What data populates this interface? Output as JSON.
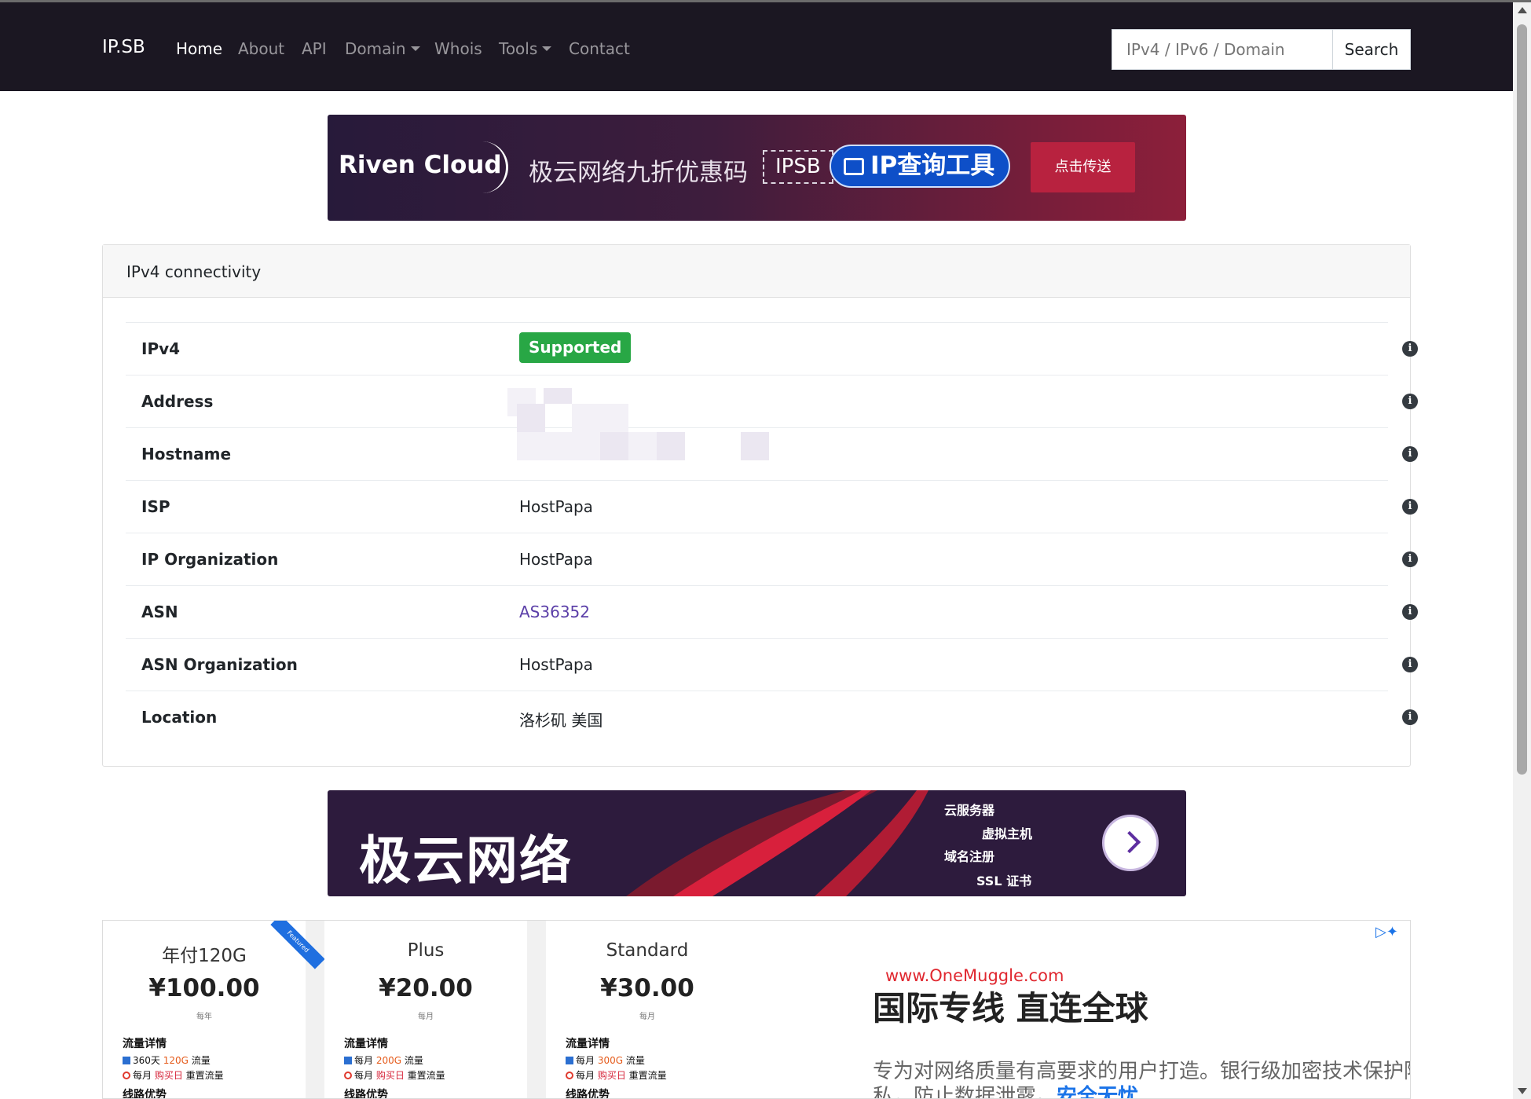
{
  "nav": {
    "brand": "IP.SB",
    "links": [
      "Home",
      "About",
      "API",
      "Domain",
      "Whois",
      "Tools",
      "Contact"
    ],
    "search_placeholder": "IPv4 / IPv6 / Domain",
    "search_button": "Search"
  },
  "banner_top": {
    "logo": "Riven Cloud",
    "text": "极云网络九折优惠码",
    "code": "IPSB",
    "tool": "IP查询工具",
    "button": "点击传送"
  },
  "card": {
    "title": "IPv4 connectivity",
    "rows": [
      {
        "label": "IPv4",
        "value": "",
        "badge": "Supported"
      },
      {
        "label": "Address",
        "value": ""
      },
      {
        "label": "Hostname",
        "value": ""
      },
      {
        "label": "ISP",
        "value": "HostPapa"
      },
      {
        "label": "IP Organization",
        "value": "HostPapa"
      },
      {
        "label": "ASN",
        "value": "AS36352"
      },
      {
        "label": "ASN Organization",
        "value": "HostPapa"
      },
      {
        "label": "Location",
        "value": "洛杉矶 美国"
      }
    ],
    "info_symbol": "i"
  },
  "banner_bottom": {
    "title": "极云网络",
    "items": [
      "云服务器",
      "虚拟主机",
      "域名注册",
      "SSL 证书"
    ]
  },
  "ad": {
    "plans": [
      {
        "name": "年付120G",
        "price": "¥100.00",
        "period": "每年",
        "detail_title": "流量详情",
        "line1_pre": "360天 ",
        "line1_hl": "120G",
        "line1_post": " 流量",
        "line2_pre": "每月 ",
        "line2_hl": "购买日",
        "line2_post": " 重置流量",
        "adv": "线路优势",
        "ribbon": "Featured"
      },
      {
        "name": "Plus",
        "price": "¥20.00",
        "period": "每月",
        "detail_title": "流量详情",
        "line1_pre": "每月 ",
        "line1_hl": "200G",
        "line1_post": " 流量",
        "line2_pre": "每月 ",
        "line2_hl": "购买日",
        "line2_post": " 重置流量",
        "adv": "线路优势"
      },
      {
        "name": "Standard",
        "price": "¥30.00",
        "period": "每月",
        "detail_title": "流量详情",
        "line1_pre": "每月 ",
        "line1_hl": "300G",
        "line1_post": " 流量",
        "line2_pre": "每月 ",
        "line2_hl": "购买日",
        "line2_post": " 重置流量",
        "adv": "线路优势"
      }
    ],
    "url": "www.OneMuggle.com",
    "headline": "国际专线 直连全球",
    "body": "专为对网络质量有高要求的用户打造。银行级加密技术保护隐私，防止数据泄露。",
    "body_hot": "安全无忧",
    "adchoices": "▷✦"
  }
}
